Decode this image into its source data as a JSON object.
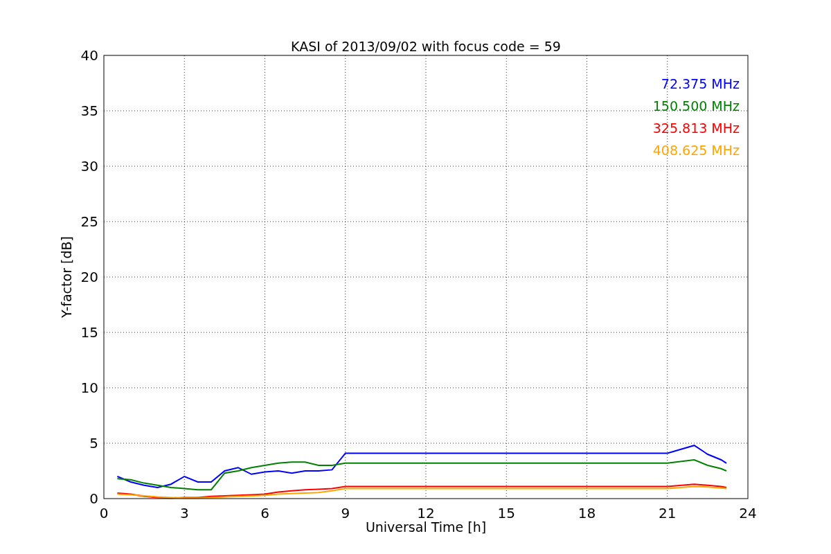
{
  "chart_data": {
    "type": "line",
    "title": "KASI of 2013/09/02 with focus code = 59",
    "xlabel": "Universal Time [h]",
    "ylabel": "Y-factor [dB]",
    "x": [
      0.5,
      1,
      1.5,
      2,
      2.5,
      3,
      3.5,
      4,
      4.5,
      5,
      5.5,
      6,
      6.5,
      7,
      7.5,
      8,
      8.5,
      9,
      12,
      15,
      18,
      21,
      22,
      22.5,
      23,
      23.2
    ],
    "series": [
      {
        "name": "72.375 MHz",
        "color": "#0000ff",
        "values": [
          2,
          1.5,
          1.2,
          1,
          1.3,
          2,
          1.5,
          1.5,
          2.5,
          2.8,
          2.2,
          2.4,
          2.5,
          2.3,
          2.5,
          2.5,
          2.6,
          4.1,
          4.1,
          4.1,
          4.1,
          4.1,
          4.8,
          4,
          3.5,
          3.2
        ]
      },
      {
        "name": "150.500 MHz",
        "color": "#008000",
        "values": [
          1.8,
          1.7,
          1.4,
          1.2,
          1,
          0.9,
          0.8,
          0.8,
          2.3,
          2.5,
          2.8,
          3,
          3.2,
          3.3,
          3.3,
          3,
          3,
          3.2,
          3.2,
          3.2,
          3.2,
          3.2,
          3.5,
          3,
          2.7,
          2.5
        ]
      },
      {
        "name": "325.813 MHz",
        "color": "#ff0000",
        "values": [
          0.5,
          0.4,
          0.2,
          0.1,
          0.05,
          0.1,
          0.1,
          0.2,
          0.25,
          0.3,
          0.35,
          0.4,
          0.6,
          0.7,
          0.8,
          0.85,
          0.9,
          1.1,
          1.1,
          1.1,
          1.1,
          1.1,
          1.3,
          1.2,
          1.1,
          1
        ]
      },
      {
        "name": "408.625 MHz",
        "color": "#ffa500",
        "values": [
          0.4,
          0.35,
          0.25,
          0.15,
          0.1,
          0.05,
          0.05,
          0.1,
          0.15,
          0.2,
          0.25,
          0.3,
          0.4,
          0.45,
          0.5,
          0.55,
          0.7,
          0.9,
          0.9,
          0.9,
          0.9,
          0.9,
          1.1,
          1.05,
          0.95,
          0.9
        ]
      }
    ],
    "grid": true,
    "xlim": [
      0,
      24
    ],
    "ylim": [
      0,
      40
    ],
    "xticks": [
      0,
      3,
      6,
      9,
      12,
      15,
      18,
      21,
      24
    ],
    "yticks": [
      0,
      5,
      10,
      15,
      20,
      25,
      30,
      35,
      40
    ]
  }
}
